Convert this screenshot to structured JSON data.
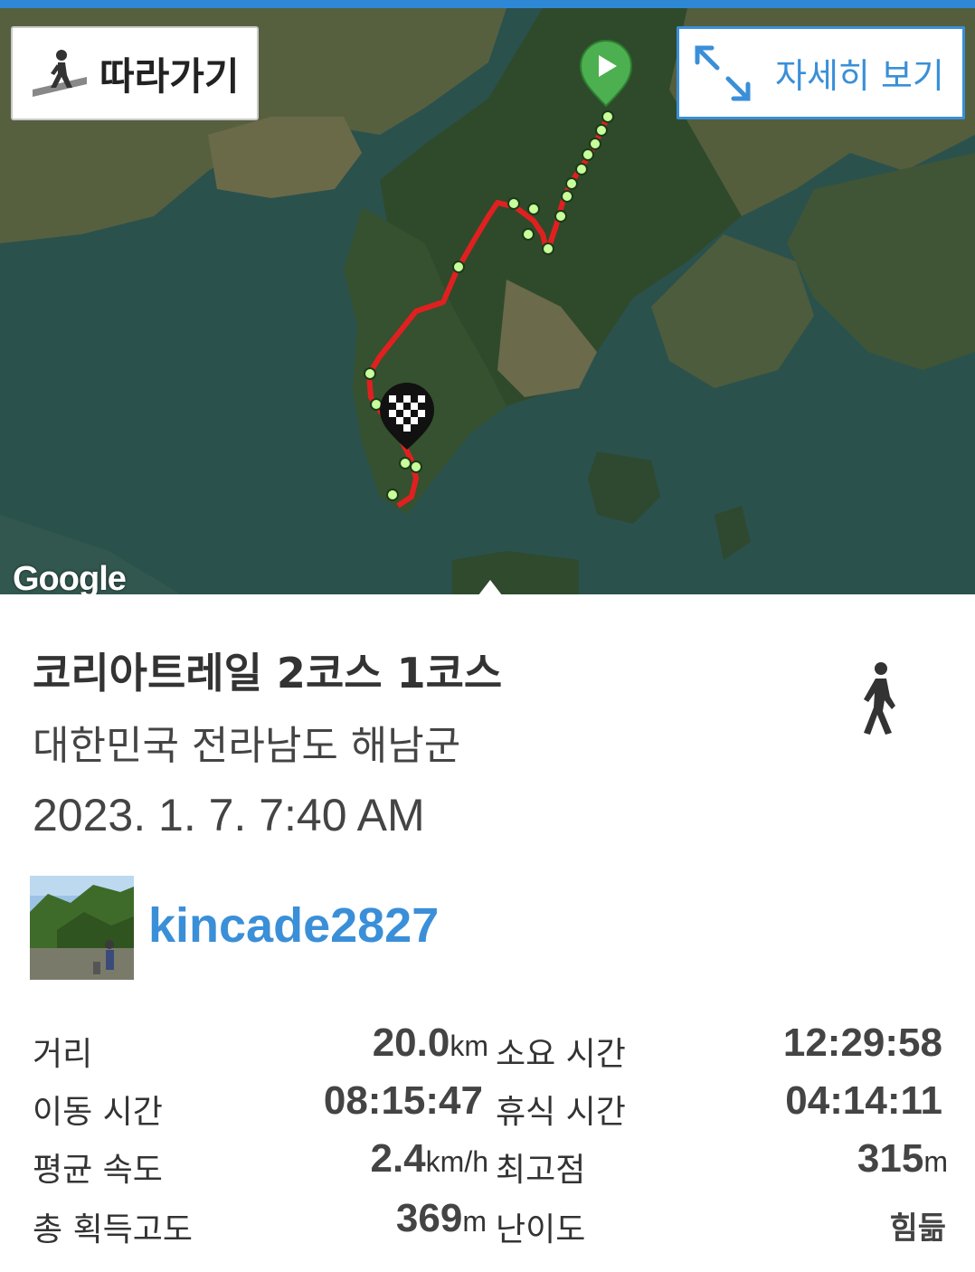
{
  "map": {
    "follow_label": "따라가기",
    "detail_label": "자세히 보기",
    "attribution": "Google",
    "icons": {
      "follow": "hiker-icon",
      "expand": "expand-arrows-icon",
      "start": "start-play-icon",
      "finish": "checkered-flag-icon"
    },
    "route_color": "#e02020"
  },
  "track": {
    "title": "코리아트레일 2코스 1코스",
    "region": "대한민국 전라남도 해남군",
    "datetime": "2023. 1. 7. 7:40 AM",
    "activity_icon": "walking-person-icon"
  },
  "user": {
    "name": "kincade2827"
  },
  "stats": {
    "distance_label": "거리",
    "distance_value": "20.0",
    "distance_unit": "km",
    "duration_label": "소요 시간",
    "duration_value": "12:29:58",
    "moving_label": "이동 시간",
    "moving_value": "08:15:47",
    "rest_label": "휴식 시간",
    "rest_value": "04:14:11",
    "speed_label": "평균 속도",
    "speed_value": "2.4",
    "speed_unit": "km/h",
    "peak_label": "최고점",
    "peak_value": "315",
    "peak_unit": "m",
    "gain_label": "총 획득고도",
    "gain_value": "369",
    "gain_unit": "m",
    "difficulty_label": "난이도",
    "difficulty_value": "힘듦"
  },
  "colors": {
    "accent": "#3a8fd8",
    "topbar": "#2f88d6"
  }
}
